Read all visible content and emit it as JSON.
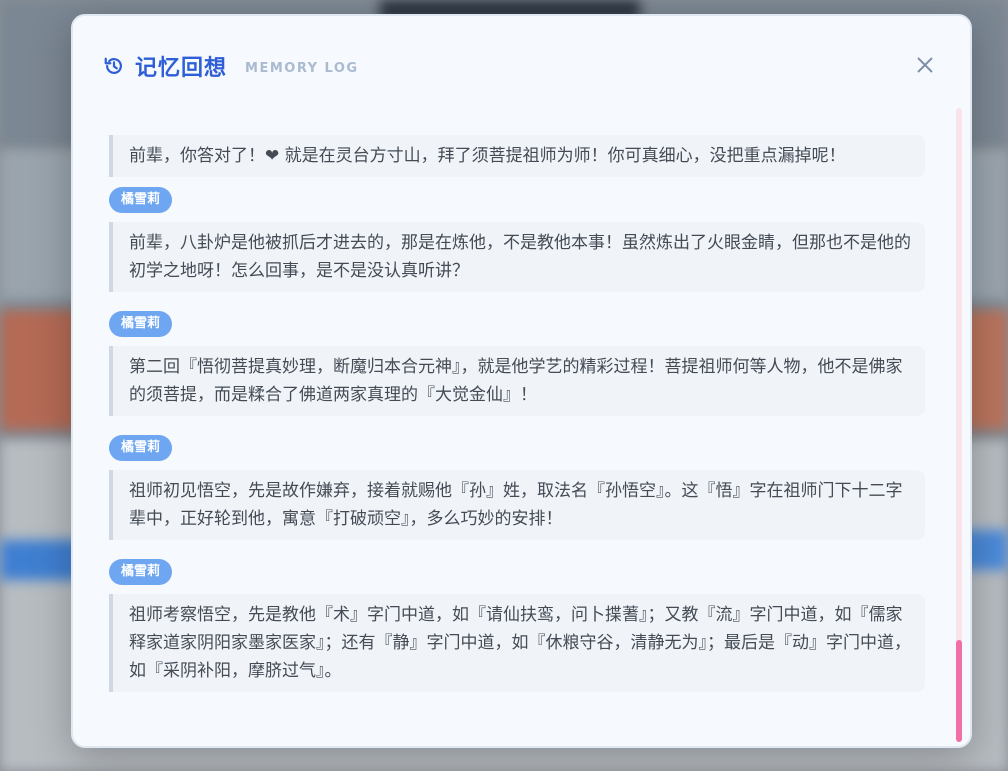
{
  "modal": {
    "title": "记忆回想",
    "subtitle": "MEMORY LOG",
    "close_label": "×"
  },
  "entries": [
    {
      "speaker": "",
      "text": "前辈，你答对了！❤ 就是在灵台方寸山，拜了须菩提祖师为师！你可真细心，没把重点漏掉呢！"
    },
    {
      "speaker": "橘雪莉",
      "text": "前辈，八卦炉是他被抓后才进去的，那是在炼他，不是教他本事！虽然炼出了火眼金睛，但那也不是他的初学之地呀！怎么回事，是不是没认真听讲？"
    },
    {
      "speaker": "橘雪莉",
      "text": "第二回『悟彻菩提真妙理，断魔归本合元神』，就是他学艺的精彩过程！菩提祖师何等人物，他不是佛家的须菩提，而是糅合了佛道两家真理的『大觉金仙』！"
    },
    {
      "speaker": "橘雪莉",
      "text": "祖师初见悟空，先是故作嫌弃，接着就赐他『孙』姓，取法名『孙悟空』。这『悟』字在祖师门下十二字辈中，正好轮到他，寓意『打破顽空』，多么巧妙的安排！"
    },
    {
      "speaker": "橘雪莉",
      "text": "祖师考察悟空，先是教他『术』字门中道，如『请仙扶鸾，问卜揲蓍』；又教『流』字门中道，如『儒家释家道家阴阳家墨家医家』；还有『静』字门中道，如『休粮守谷，清静无为』；最后是『动』字门中道，如『采阴补阳，摩脐过气』。"
    }
  ],
  "colors": {
    "accent": "#2f5fd6",
    "tag": "#6fa6f2",
    "scrollbar": "#ef6fa6"
  }
}
